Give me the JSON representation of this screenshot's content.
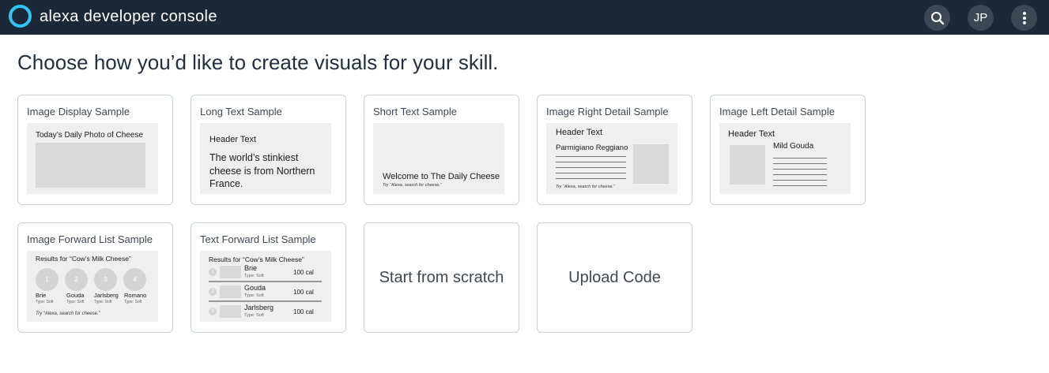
{
  "header": {
    "app_title": "alexa developer console",
    "avatar_initials": "JP",
    "brand_color": "#31c4f3",
    "bar_color": "#1b2838"
  },
  "page": {
    "title": "Choose how you’d like to create visuals for your skill."
  },
  "cards": {
    "image_display": {
      "title": "Image Display Sample",
      "header": "Today’s Daily Photo of Cheese"
    },
    "long_text": {
      "title": "Long Text Sample",
      "header": "Header Text",
      "body": "The world’s stinkiest cheese is from Northern France."
    },
    "short_text": {
      "title": "Short Text Sample",
      "body": "Welcome to The Daily Cheese",
      "hint": "Try “Alexa, search for cheese.”"
    },
    "image_right_detail": {
      "title": "Image Right Detail Sample",
      "header": "Header Text",
      "subheader": "Parmigiano Reggiano",
      "hint": "Try “Alexa, search for cheese.”"
    },
    "image_left_detail": {
      "title": "Image Left Detail Sample",
      "header": "Header Text",
      "subheader": "Mild Gouda"
    },
    "image_forward_list": {
      "title": "Image Forward List Sample",
      "header": "Results for “Cow’s Milk Cheese”",
      "items": [
        {
          "num": "1",
          "name": "Brie",
          "type": "Type: Soft"
        },
        {
          "num": "2",
          "name": "Gouda",
          "type": "Type: Soft"
        },
        {
          "num": "3",
          "name": "Jarlsberg",
          "type": "Type: Soft"
        },
        {
          "num": "4",
          "name": "Romano",
          "type": "Type: Soft"
        }
      ],
      "hint": "Try “Alexa, search for cheese.”"
    },
    "text_forward_list": {
      "title": "Text Forward List Sample",
      "header": "Results for “Cow’s Milk Cheese”",
      "rows": [
        {
          "num": "1",
          "name": "Brie",
          "type": "Type: Soft",
          "cal": "100 cal"
        },
        {
          "num": "2",
          "name": "Gouda",
          "type": "Type: Soft",
          "cal": "100 cal"
        },
        {
          "num": "3",
          "name": "Jarlsberg",
          "type": "Type: Soft",
          "cal": "100 cal"
        }
      ]
    },
    "scratch": {
      "label": "Start from scratch"
    },
    "upload": {
      "label": "Upload Code"
    }
  }
}
